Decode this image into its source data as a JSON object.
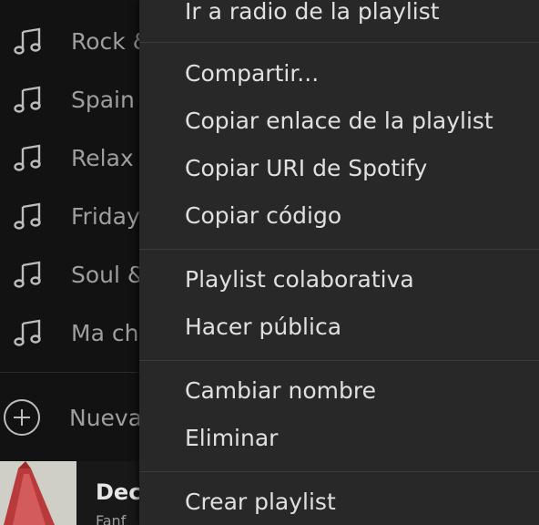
{
  "sidebar": {
    "playlists": [
      {
        "label": "Rock &",
        "icon": "music-note-icon"
      },
      {
        "label": "Spain",
        "icon": "music-note-icon"
      },
      {
        "label": "Relax",
        "icon": "music-note-icon"
      },
      {
        "label": "Friday",
        "icon": "music-note-icon"
      },
      {
        "label": "Soul &",
        "icon": "music-note-icon"
      },
      {
        "label": "Ma ch",
        "icon": "music-note-icon"
      }
    ],
    "new_playlist_label": "Nueva",
    "new_playlist_icon": "plus-circle-icon"
  },
  "now_playing": {
    "title": "Dec",
    "artist": "Fanf"
  },
  "context_menu": {
    "items": [
      "Ir a radio de la playlist",
      "Compartir...",
      "Copiar enlace de la playlist",
      "Copiar URI de Spotify",
      "Copiar código",
      "Playlist colaborativa",
      "Hacer pública",
      "Cambiar nombre",
      "Eliminar",
      "Crear playlist"
    ]
  },
  "colors": {
    "background": "#121212",
    "menu_background": "#282828",
    "text_primary": "#e0e0e0",
    "text_secondary": "#9e9e9e"
  }
}
